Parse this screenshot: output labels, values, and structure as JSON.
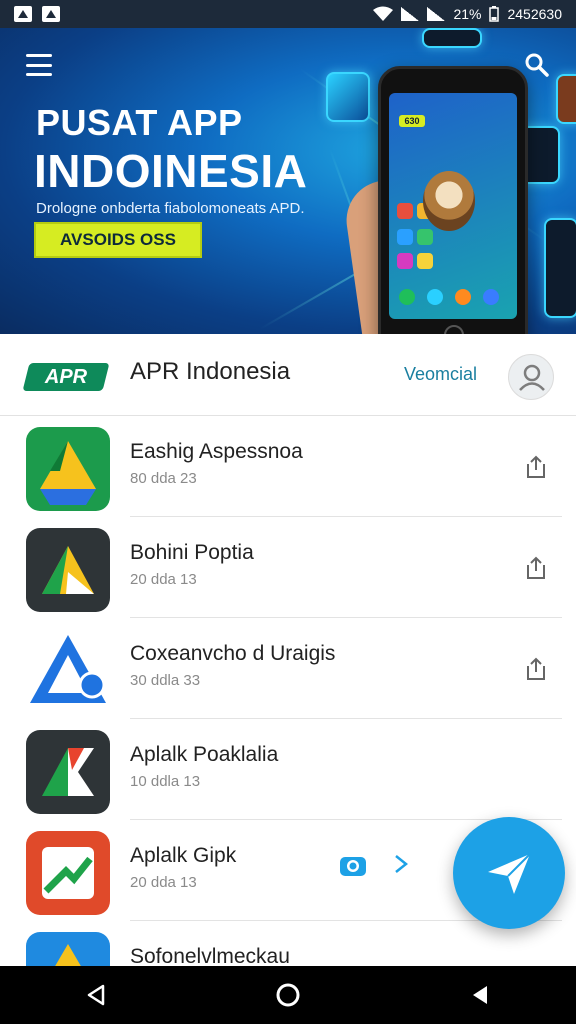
{
  "status_bar": {
    "battery": "21%",
    "time": "2452630"
  },
  "banner": {
    "title_line1": "PUSAT APP",
    "title_line2": "INDOINESIA",
    "subtitle": "Drologne onbderta fiabolomoneats APD.",
    "cta_label": "AVSOIDS OSS",
    "phone_widget_text": "630",
    "accent_color": "#d6ec22"
  },
  "header": {
    "logo_text": "APR",
    "app_name": "APR Indonesia",
    "action_label": "Veomcial",
    "brand_color": "#0e8a5a"
  },
  "apps": [
    {
      "name": "Eashig Aspessnoa",
      "meta": "80 dda 23",
      "icon": "triangle-drive-icon"
    },
    {
      "name": "Bohini Poptia",
      "meta": "20 dda 13",
      "icon": "triangle-drive-dark-icon"
    },
    {
      "name": "Coxeanvcho d Uraigis",
      "meta": "30 ddla 33",
      "icon": "blue-a-icon"
    },
    {
      "name": "Aplalk Poaklalia",
      "meta": "10 ddla 13",
      "icon": "dark-flag-icon"
    },
    {
      "name": "Aplalk Gipk",
      "meta": "20 dda 13",
      "icon": "red-check-icon"
    },
    {
      "name": "Sofonelvlmeckau",
      "meta": "",
      "icon": "yellow-triangle-icon"
    }
  ]
}
